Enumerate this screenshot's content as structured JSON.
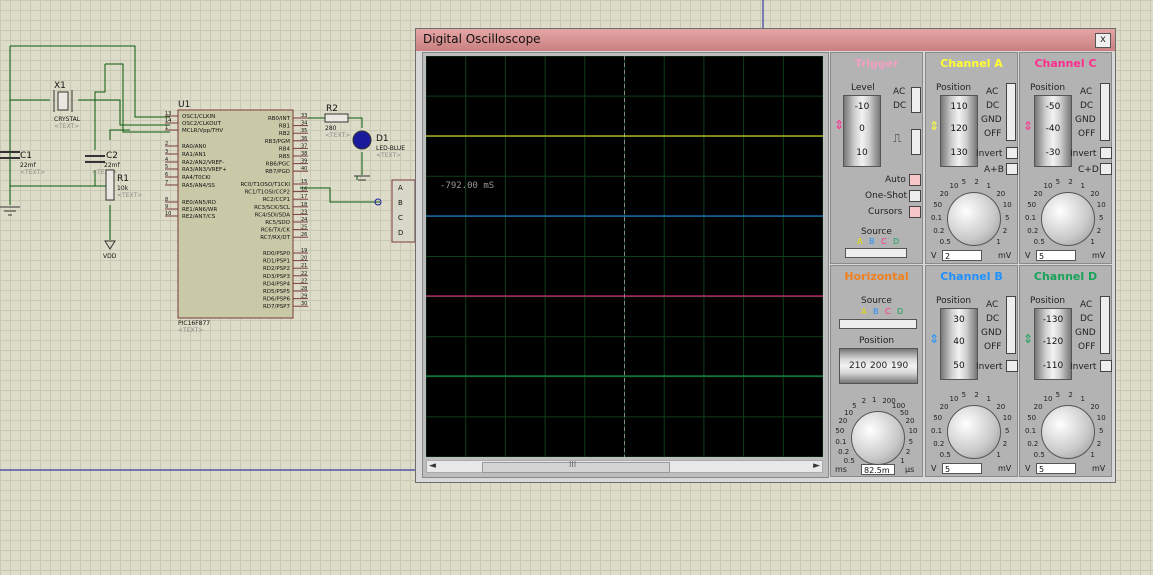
{
  "schematic": {
    "x1": {
      "ref": "X1",
      "type": "CRYSTAL",
      "text": "<TEXT>"
    },
    "c1": {
      "ref": "C1",
      "value": "22mf",
      "text": "<TEXT>"
    },
    "c2": {
      "ref": "C2",
      "value": "22mf",
      "text": "<TEXT>"
    },
    "r1": {
      "ref": "R1",
      "value": "10k",
      "text": "<TEXT>"
    },
    "r2": {
      "ref": "R2",
      "value": "280",
      "text": "<TEXT>"
    },
    "d1": {
      "ref": "D1",
      "type": "LED-BLUE",
      "text": "<TEXT>"
    },
    "vdd": "VDD",
    "u1": {
      "ref": "U1",
      "part": "PIC16F877",
      "text": "<TEXT>"
    },
    "u1_left_pins": [
      {
        "num": "13",
        "name": "OSC1/CLKIN"
      },
      {
        "num": "14",
        "name": "OSC2/CLKOUT"
      },
      {
        "num": "1",
        "name": "MCLR/Vpp/THV"
      },
      {
        "num": "2",
        "name": "RA0/AN0"
      },
      {
        "num": "3",
        "name": "RA1/AN1"
      },
      {
        "num": "4",
        "name": "RA2/AN2/VREF-"
      },
      {
        "num": "5",
        "name": "RA3/AN3/VREF+"
      },
      {
        "num": "6",
        "name": "RA4/T0CKI"
      },
      {
        "num": "7",
        "name": "RA5/AN4/SS"
      },
      {
        "num": "8",
        "name": "RE0/AN5/RD"
      },
      {
        "num": "9",
        "name": "RE1/AN6/WR"
      },
      {
        "num": "10",
        "name": "RE2/AN7/CS"
      }
    ],
    "u1_right_pins": [
      {
        "num": "33",
        "name": "RB0/INT"
      },
      {
        "num": "34",
        "name": "RB1"
      },
      {
        "num": "35",
        "name": "RB2"
      },
      {
        "num": "36",
        "name": "RB3/PGM"
      },
      {
        "num": "37",
        "name": "RB4"
      },
      {
        "num": "38",
        "name": "RB5"
      },
      {
        "num": "39",
        "name": "RB6/PGC"
      },
      {
        "num": "40",
        "name": "RB7/PGD"
      },
      {
        "num": "15",
        "name": "RC0/T1OSO/T1CKI"
      },
      {
        "num": "16",
        "name": "RC1/T1OSI/CCP2"
      },
      {
        "num": "17",
        "name": "RC2/CCP1"
      },
      {
        "num": "18",
        "name": "RC3/SCK/SCL"
      },
      {
        "num": "23",
        "name": "RC4/SDI/SDA"
      },
      {
        "num": "24",
        "name": "RC5/SDO"
      },
      {
        "num": "25",
        "name": "RC6/TX/CK"
      },
      {
        "num": "26",
        "name": "RC7/RX/DT"
      },
      {
        "num": "19",
        "name": "RD0/PSP0"
      },
      {
        "num": "20",
        "name": "RD1/PSP1"
      },
      {
        "num": "21",
        "name": "RD2/PSP2"
      },
      {
        "num": "22",
        "name": "RD3/PSP3"
      },
      {
        "num": "27",
        "name": "RD4/PSP4"
      },
      {
        "num": "28",
        "name": "RD5/PSP5"
      },
      {
        "num": "29",
        "name": "RD6/PSP6"
      },
      {
        "num": "30",
        "name": "RD7/PSP7"
      }
    ],
    "probe_pins": [
      "A",
      "B",
      "C",
      "D"
    ]
  },
  "oscilloscope": {
    "title": "Digital Oscilloscope",
    "close": "x",
    "time_readout": "-792.00 mS",
    "scroll_grip": "III",
    "trigger": {
      "title": "Trigger",
      "level_label": "Level",
      "level_ticks": [
        "-10",
        "0",
        "10"
      ],
      "ac": "AC",
      "dc": "DC",
      "auto": "Auto",
      "one_shot": "One-Shot",
      "cursors": "Cursors",
      "source_label": "Source",
      "sources": [
        "A",
        "B",
        "C",
        "D"
      ]
    },
    "horizontal": {
      "title": "Horizontal",
      "source_label": "Source",
      "sources": [
        "A",
        "B",
        "C",
        "D"
      ],
      "position_label": "Position",
      "position_ticks": [
        "210",
        "200",
        "190"
      ],
      "unit_left": "ms",
      "value": "82.5m",
      "unit_right": "µs"
    },
    "channels": [
      {
        "id": "A",
        "title": "Channel A",
        "color": "#ffff33",
        "ticks": [
          "110",
          "120",
          "130"
        ],
        "extra": "A+B",
        "value": "2",
        "unit_left": "V",
        "unit_right": "mV"
      },
      {
        "id": "C",
        "title": "Channel C",
        "color": "#ff2d8c",
        "ticks": [
          "-50",
          "-40",
          "-30"
        ],
        "extra": "C+D",
        "value": "5",
        "unit_left": "V",
        "unit_right": "mV"
      },
      {
        "id": "B",
        "title": "Channel B",
        "color": "#1e90ff",
        "ticks": [
          "30",
          "40",
          "50"
        ],
        "extra": "",
        "value": "5",
        "unit_left": "V",
        "unit_right": "mV"
      },
      {
        "id": "D",
        "title": "Channel D",
        "color": "#18a35a",
        "ticks": [
          "-130",
          "-120",
          "-110"
        ],
        "extra": "",
        "value": "5",
        "unit_left": "V",
        "unit_right": "mV"
      }
    ],
    "coupling": {
      "position": "Position",
      "ac": "AC",
      "dc": "DC",
      "gnd": "GND",
      "off": "OFF",
      "invert": "Invert"
    },
    "knob_scale_v": [
      "0.5",
      "0.2",
      "0.1",
      "50",
      "20",
      "10",
      "5",
      "2",
      "1",
      "20",
      "10",
      "5",
      "2",
      "1"
    ],
    "knob_scale_h": [
      "0.5",
      "0.2",
      "0.1",
      "50",
      "20",
      "10",
      "5",
      "2",
      "1",
      "200",
      "100",
      "50",
      "20",
      "10",
      "5",
      "2",
      "1"
    ]
  }
}
